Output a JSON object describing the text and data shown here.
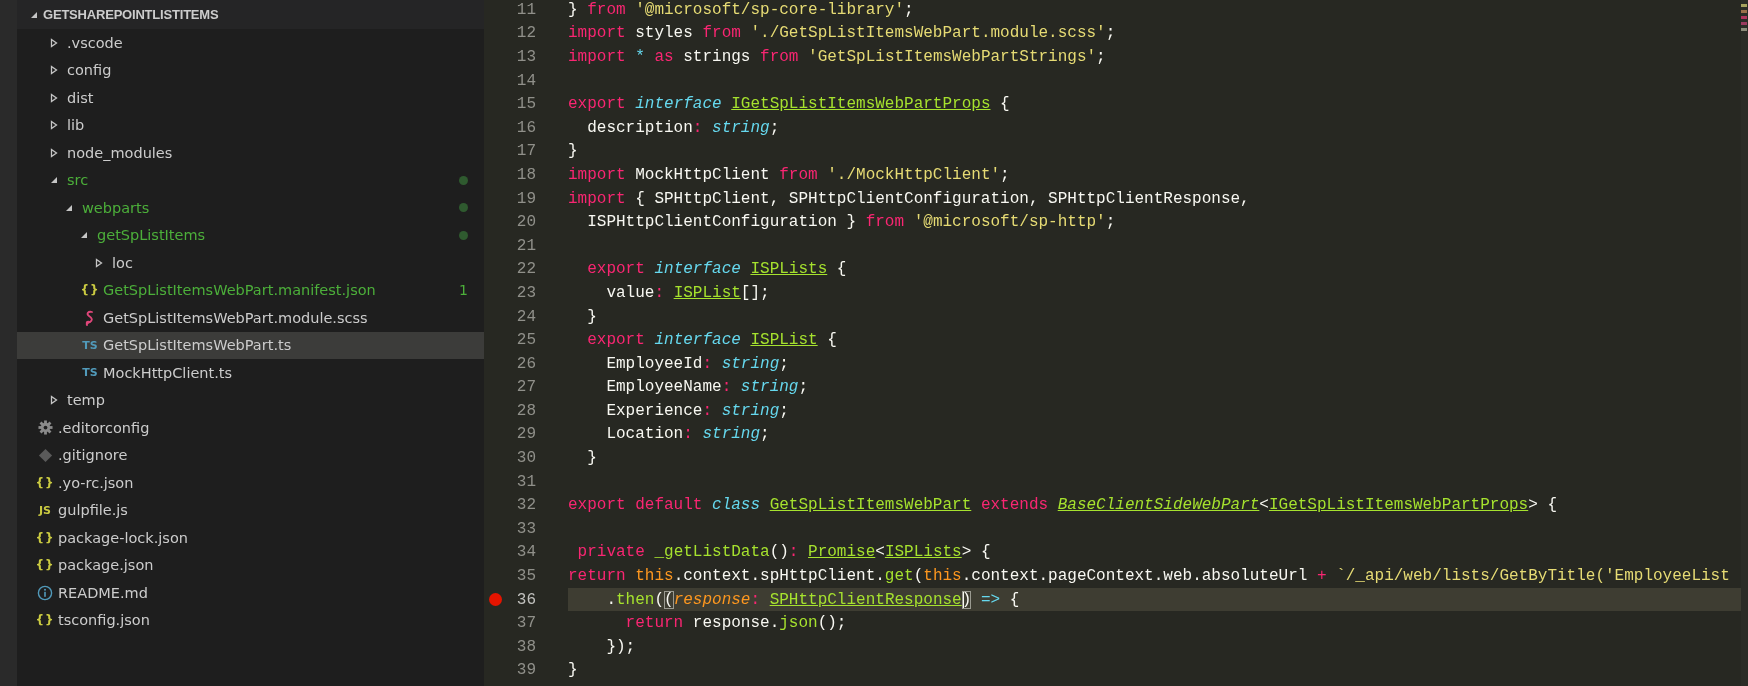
{
  "explorer": {
    "title": "GETSHAREPOINTLISTITEMS",
    "expanded": true,
    "items": [
      {
        "kind": "folder",
        "name": ".vscode",
        "expanded": false,
        "selected": false,
        "modified": false
      },
      {
        "kind": "folder",
        "name": "config",
        "expanded": false,
        "selected": false,
        "modified": false
      },
      {
        "kind": "folder",
        "name": "dist",
        "expanded": false,
        "selected": false,
        "modified": false
      },
      {
        "kind": "folder",
        "name": "lib",
        "expanded": false,
        "selected": false,
        "modified": false
      },
      {
        "kind": "folder",
        "name": "node_modules",
        "expanded": false,
        "selected": false,
        "modified": false
      },
      {
        "kind": "folder",
        "name": "src",
        "expanded": true,
        "selected": false,
        "modified": true,
        "children": [
          {
            "kind": "folder",
            "name": "webparts",
            "expanded": true,
            "selected": false,
            "modified": true,
            "children": [
              {
                "kind": "folder",
                "name": "getSpListItems",
                "expanded": true,
                "selected": false,
                "modified": true,
                "children": [
                  {
                    "kind": "folder",
                    "name": "loc",
                    "expanded": false,
                    "selected": false,
                    "modified": false
                  },
                  {
                    "kind": "json",
                    "icon_text": "{}",
                    "name": "GetSpListItemsWebPart.manifest.json",
                    "selected": false,
                    "modified": true,
                    "badge": "1"
                  },
                  {
                    "kind": "scss",
                    "name": "GetSpListItemsWebPart.module.scss",
                    "selected": false,
                    "modified": false
                  },
                  {
                    "kind": "ts",
                    "icon_text": "TS",
                    "name": "GetSpListItemsWebPart.ts",
                    "selected": true,
                    "modified": false
                  },
                  {
                    "kind": "ts",
                    "icon_text": "TS",
                    "name": "MockHttpClient.ts",
                    "selected": false,
                    "modified": false
                  }
                ]
              }
            ]
          }
        ]
      },
      {
        "kind": "folder",
        "name": "temp",
        "expanded": false,
        "selected": false,
        "modified": false
      },
      {
        "kind": "config",
        "name": ".editorconfig",
        "selected": false,
        "modified": false
      },
      {
        "kind": "git",
        "name": ".gitignore",
        "selected": false,
        "modified": false
      },
      {
        "kind": "json",
        "icon_text": "{}",
        "name": ".yo-rc.json",
        "selected": false,
        "modified": false
      },
      {
        "kind": "js",
        "icon_text": "JS",
        "name": "gulpfile.js",
        "selected": false,
        "modified": false
      },
      {
        "kind": "json",
        "icon_text": "{}",
        "name": "package-lock.json",
        "selected": false,
        "modified": false
      },
      {
        "kind": "json",
        "icon_text": "{}",
        "name": "package.json",
        "selected": false,
        "modified": false
      },
      {
        "kind": "info",
        "name": "README.md",
        "selected": false,
        "modified": false
      },
      {
        "kind": "json",
        "icon_text": "{}",
        "name": "tsconfig.json",
        "selected": false,
        "modified": false
      }
    ]
  },
  "editor": {
    "lines": [
      {
        "number": "11",
        "current": false,
        "breakpoint": false,
        "tokens": [
          {
            "kind": "plain",
            "text": "} "
          },
          {
            "kind": "kw",
            "text": "from "
          },
          {
            "kind": "str",
            "text": "'@microsoft/sp-core-library'"
          },
          {
            "kind": "plain",
            "text": ";"
          }
        ]
      },
      {
        "number": "12",
        "current": false,
        "breakpoint": false,
        "tokens": [
          {
            "kind": "kw",
            "text": "import"
          },
          {
            "kind": "plain",
            "text": " styles "
          },
          {
            "kind": "kw",
            "text": "from "
          },
          {
            "kind": "str",
            "text": "'./GetSpListItemsWebPart.module.scss'"
          },
          {
            "kind": "plain",
            "text": ";"
          }
        ]
      },
      {
        "number": "13",
        "current": false,
        "breakpoint": false,
        "tokens": [
          {
            "kind": "kw",
            "text": "import "
          },
          {
            "kind": "op",
            "text": "* "
          },
          {
            "kind": "kw",
            "text": "as"
          },
          {
            "kind": "plain",
            "text": " strings "
          },
          {
            "kind": "kw",
            "text": "from "
          },
          {
            "kind": "str",
            "text": "'GetSpListItemsWebPartStrings'"
          },
          {
            "kind": "plain",
            "text": ";"
          }
        ]
      },
      {
        "number": "14",
        "current": false,
        "breakpoint": false
      },
      {
        "number": "15",
        "current": false,
        "breakpoint": false,
        "tokens": [
          {
            "kind": "kw",
            "text": "export "
          },
          {
            "kind": "storage",
            "text": "interface "
          },
          {
            "kind": "type",
            "text": "IGetSpListItemsWebPartProps"
          },
          {
            "kind": "plain",
            "text": " {"
          }
        ]
      },
      {
        "number": "16",
        "current": false,
        "breakpoint": false,
        "tokens": [
          {
            "kind": "plain",
            "text": "  description"
          },
          {
            "kind": "kw",
            "text": ": "
          },
          {
            "kind": "storage",
            "text": "string"
          },
          {
            "kind": "plain",
            "text": ";"
          }
        ]
      },
      {
        "number": "17",
        "current": false,
        "breakpoint": false,
        "tokens": [
          {
            "kind": "plain",
            "text": "}"
          }
        ]
      },
      {
        "number": "18",
        "current": false,
        "breakpoint": false,
        "tokens": [
          {
            "kind": "kw",
            "text": "import"
          },
          {
            "kind": "plain",
            "text": " MockHttpClient "
          },
          {
            "kind": "kw",
            "text": "from "
          },
          {
            "kind": "str",
            "text": "'./MockHttpClient'"
          },
          {
            "kind": "plain",
            "text": ";"
          }
        ]
      },
      {
        "number": "19",
        "current": false,
        "breakpoint": false,
        "tokens": [
          {
            "kind": "kw",
            "text": "import"
          },
          {
            "kind": "plain",
            "text": " { SPHttpClient, SPHttpClientConfiguration, SPHttpClientResponse,"
          }
        ]
      },
      {
        "number": "20",
        "current": false,
        "breakpoint": false,
        "tokens": [
          {
            "kind": "plain",
            "text": "  ISPHttpClientConfiguration } "
          },
          {
            "kind": "kw",
            "text": "from "
          },
          {
            "kind": "str",
            "text": "'@microsoft/sp-http'"
          },
          {
            "kind": "plain",
            "text": ";"
          }
        ]
      },
      {
        "number": "21",
        "current": false,
        "breakpoint": false
      },
      {
        "number": "22",
        "current": false,
        "breakpoint": false,
        "tokens": [
          {
            "kind": "kw",
            "text": "  export "
          },
          {
            "kind": "storage",
            "text": "interface "
          },
          {
            "kind": "type",
            "text": "ISPLists"
          },
          {
            "kind": "plain",
            "text": " {"
          }
        ]
      },
      {
        "number": "23",
        "current": false,
        "breakpoint": false,
        "tokens": [
          {
            "kind": "plain",
            "text": "    value"
          },
          {
            "kind": "kw",
            "text": ": "
          },
          {
            "kind": "type",
            "text": "ISPList"
          },
          {
            "kind": "plain",
            "text": "[];"
          }
        ]
      },
      {
        "number": "24",
        "current": false,
        "breakpoint": false,
        "tokens": [
          {
            "kind": "plain",
            "text": "  }"
          }
        ]
      },
      {
        "number": "25",
        "current": false,
        "breakpoint": false,
        "tokens": [
          {
            "kind": "kw",
            "text": "  export "
          },
          {
            "kind": "storage",
            "text": "interface "
          },
          {
            "kind": "type",
            "text": "ISPList"
          },
          {
            "kind": "plain",
            "text": " {"
          }
        ]
      },
      {
        "number": "26",
        "current": false,
        "breakpoint": false,
        "tokens": [
          {
            "kind": "plain",
            "text": "    EmployeeId"
          },
          {
            "kind": "kw",
            "text": ": "
          },
          {
            "kind": "storage",
            "text": "string"
          },
          {
            "kind": "plain",
            "text": ";"
          }
        ]
      },
      {
        "number": "27",
        "current": false,
        "breakpoint": false,
        "tokens": [
          {
            "kind": "plain",
            "text": "    EmployeeName"
          },
          {
            "kind": "kw",
            "text": ": "
          },
          {
            "kind": "storage",
            "text": "string"
          },
          {
            "kind": "plain",
            "text": ";"
          }
        ]
      },
      {
        "number": "28",
        "current": false,
        "breakpoint": false,
        "tokens": [
          {
            "kind": "plain",
            "text": "    Experience"
          },
          {
            "kind": "kw",
            "text": ": "
          },
          {
            "kind": "storage",
            "text": "string"
          },
          {
            "kind": "plain",
            "text": ";"
          }
        ]
      },
      {
        "number": "29",
        "current": false,
        "breakpoint": false,
        "tokens": [
          {
            "kind": "plain",
            "text": "    Location"
          },
          {
            "kind": "kw",
            "text": ": "
          },
          {
            "kind": "storage",
            "text": "string"
          },
          {
            "kind": "plain",
            "text": ";"
          }
        ]
      },
      {
        "number": "30",
        "current": false,
        "breakpoint": false,
        "tokens": [
          {
            "kind": "plain",
            "text": "  }"
          }
        ]
      },
      {
        "number": "31",
        "current": false,
        "breakpoint": false
      },
      {
        "number": "32",
        "current": false,
        "breakpoint": false,
        "tokens": [
          {
            "kind": "kw",
            "text": "export default "
          },
          {
            "kind": "storage",
            "text": "class "
          },
          {
            "kind": "type",
            "text": "GetSpListItemsWebPart"
          },
          {
            "kind": "kw",
            "text": " extends "
          },
          {
            "kind": "type-italic",
            "text": "BaseClientSideWebPart"
          },
          {
            "kind": "plain",
            "text": "<"
          },
          {
            "kind": "type",
            "text": "IGetSpListItemsWebPartProps"
          },
          {
            "kind": "plain",
            "text": "> {"
          }
        ]
      },
      {
        "number": "33",
        "current": false,
        "breakpoint": false
      },
      {
        "number": "34",
        "current": false,
        "breakpoint": false,
        "tokens": [
          {
            "kind": "kw",
            "text": " private "
          },
          {
            "kind": "func",
            "text": "_getListData"
          },
          {
            "kind": "plain",
            "text": "()"
          },
          {
            "kind": "kw",
            "text": ": "
          },
          {
            "kind": "type",
            "text": "Promise"
          },
          {
            "kind": "plain",
            "text": "<"
          },
          {
            "kind": "type",
            "text": "ISPLists"
          },
          {
            "kind": "plain",
            "text": "> {"
          }
        ]
      },
      {
        "number": "35",
        "current": false,
        "breakpoint": false,
        "tokens": [
          {
            "kind": "kw",
            "text": "return "
          },
          {
            "kind": "this",
            "text": "this"
          },
          {
            "kind": "plain",
            "text": ".context.spHttpClient."
          },
          {
            "kind": "func",
            "text": "get"
          },
          {
            "kind": "plain",
            "text": "("
          },
          {
            "kind": "this",
            "text": "this"
          },
          {
            "kind": "plain",
            "text": ".context.pageContext.web.absoluteUrl "
          },
          {
            "kind": "kw",
            "text": "+ "
          },
          {
            "kind": "str",
            "text": "`/_api/web/lists/GetByTitle('EmployeeList"
          }
        ]
      },
      {
        "number": "36",
        "current": true,
        "breakpoint": true,
        "tokens": [
          {
            "kind": "plain",
            "text": "    ."
          },
          {
            "kind": "func",
            "text": "then"
          },
          {
            "kind": "plain",
            "text": "("
          },
          {
            "kind": "bracket",
            "text": "("
          },
          {
            "kind": "param",
            "text": "response"
          },
          {
            "kind": "kw",
            "text": ": "
          },
          {
            "kind": "type",
            "text": "SPHttpClientResponse"
          },
          {
            "kind": "bracket-cursor",
            "text": ")"
          },
          {
            "kind": "op",
            "text": " => "
          },
          {
            "kind": "plain",
            "text": "{"
          }
        ]
      },
      {
        "number": "37",
        "current": false,
        "breakpoint": false,
        "tokens": [
          {
            "kind": "kw",
            "text": "      return"
          },
          {
            "kind": "plain",
            "text": " response."
          },
          {
            "kind": "func",
            "text": "json"
          },
          {
            "kind": "plain",
            "text": "();"
          }
        ]
      },
      {
        "number": "38",
        "current": false,
        "breakpoint": false,
        "tokens": [
          {
            "kind": "plain",
            "text": "    });"
          }
        ]
      },
      {
        "number": "39",
        "current": false,
        "breakpoint": false,
        "tokens": [
          {
            "kind": "plain",
            "text": "}"
          }
        ]
      }
    ]
  }
}
